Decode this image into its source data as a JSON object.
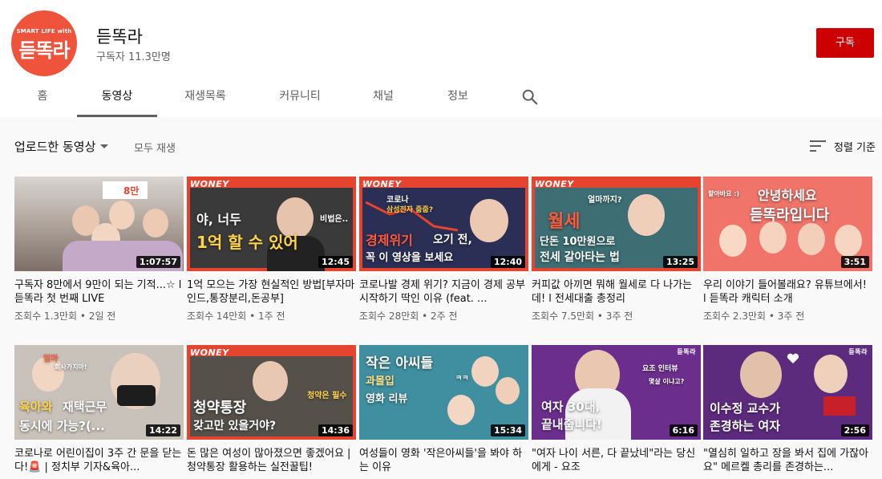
{
  "channel": {
    "avatar_small": "SMART LIFE with",
    "avatar_main": "듣똑라",
    "name": "듣똑라",
    "subscribers": "구독자 11.3만명",
    "subscribe_label": "구독"
  },
  "tabs": [
    "홈",
    "동영상",
    "재생목록",
    "커뮤니티",
    "채널",
    "정보"
  ],
  "active_tab": "동영상",
  "toolbar": {
    "uploads": "업로드한 동영상",
    "play_all": "모두 재생",
    "sort": "정렬 기준"
  },
  "videos": [
    {
      "title": "구독자 8만에서 9만이 되는 기적...☆ l 듣똑라 첫 번째 LIVE",
      "meta": "조회수 1.3만회 • 2일 전",
      "duration": "1:07:57",
      "thumb_text": [
        "8만"
      ],
      "colors": {
        "bg": "#8a7f7a",
        "accent": "#e8dcd5"
      }
    },
    {
      "title": "1억 모으는 가장 현실적인 방법[부자마인드,통장분리,돈공부]",
      "meta": "조회수 14만회 • 1주 전",
      "duration": "12:45",
      "brand": "WONEY",
      "thumb_text": [
        "야, 너두",
        "1억 할 수 있어",
        "비법은.."
      ],
      "colors": {
        "bg": "#3a3a3a",
        "frame": "#e5442f"
      }
    },
    {
      "title": "코로나발 경제 위기? 지금이 경제 공부 시작하기 딱인 이유 (feat. ...",
      "meta": "조회수 28만회 • 2주 전",
      "duration": "12:40",
      "brand": "WONEY",
      "thumb_text": [
        "코로나",
        "삼성전자 줍줍?",
        "경제위기",
        "오기 전,",
        "꼭 이 영상을 보세요"
      ],
      "colors": {
        "bg": "#2b2f55",
        "frame": "#e5442f"
      }
    },
    {
      "title": "커피값 아끼면 뭐해 월세로 다 나가는데! l 전세대출 총정리",
      "meta": "조회수 7.5만회 • 3주 전",
      "duration": "13:25",
      "brand": "WONEY",
      "thumb_text": [
        "얼마까지?",
        "월세",
        "단돈 10만원으로",
        "전세 갈아타는 법"
      ],
      "colors": {
        "bg": "#3c6e73",
        "frame": "#e5442f"
      }
    },
    {
      "title": "우리 이야기 들어볼래요? 유튜브에서! l 듣똑라 캐릭터 소개",
      "meta": "조회수 2.3만회 • 3주 전",
      "duration": "3:51",
      "thumb_text": [
        "안녕하세요",
        "듣똑라입니다",
        "할아바요 :)"
      ],
      "colors": {
        "bg": "#f0746a"
      }
    },
    {
      "title": "코로나로 어린이집이 3주 간 문을 닫는다!🚨 | 정치부 기자&육아...",
      "meta": "",
      "duration": "14:22",
      "thumb_text": [
        "엄마",
        "회사가지마!",
        "육아와",
        "재택근무",
        "동시에 가능?(..."
      ],
      "colors": {
        "bg": "#c9c2bb"
      }
    },
    {
      "title": "돈 많은 여성이 많아졌으면 좋겠어요 | 청약통장 활용하는 실전꿀팁!",
      "meta": "",
      "duration": "14:36",
      "brand": "WONEY",
      "thumb_text": [
        "청약통장",
        "갖고만 있을거야?",
        "청약은 필수"
      ],
      "colors": {
        "bg": "#55504a",
        "frame": "#e5442f"
      }
    },
    {
      "title": "여성들이 영화 '작은아씨들'을 봐야 하는 이유",
      "meta": "",
      "duration": "15:34",
      "thumb_text": [
        "작은 아씨들",
        "과몰입",
        "영화 리뷰",
        "ㅋㅋ"
      ],
      "colors": {
        "bg": "#3f8fa0"
      }
    },
    {
      "title": "\"여자 나이 서른, 다 끝났네\"라는 당신에게 - 요조",
      "meta": "",
      "duration": "6:16",
      "brand": "듣똑라",
      "thumb_text": [
        "요조 인터뷰",
        "몇살 이냐고?",
        "여자 30대,",
        "끝내줍니다!"
      ],
      "colors": {
        "bg": "#6b2e8c"
      }
    },
    {
      "title": "\"열심히 일하고 장을 봐서 집에 가잖아요\" 메르켈 총리를 존경하는...",
      "meta": "",
      "duration": "2:56",
      "brand": "듣똑라",
      "thumb_text": [
        "이수정 교수가",
        "존경하는 여자"
      ],
      "colors": {
        "bg": "#5d2b7d"
      }
    }
  ]
}
